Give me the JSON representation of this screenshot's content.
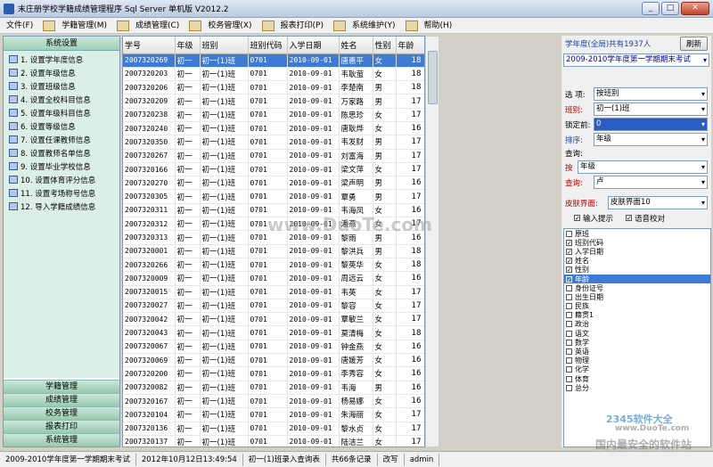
{
  "window": {
    "title": "末庄册学校学籍成绩管理程序 Sql Server 单机版 V2012.2",
    "min": "_",
    "max": "□",
    "close": "✕"
  },
  "menu": [
    "文件(F)",
    "学籍管理(M)",
    "成绩管理(C)",
    "校务管理(X)",
    "报表打印(P)",
    "系统维护(Y)",
    "帮助(H)"
  ],
  "left": {
    "header": "系统设置",
    "items": [
      "1. 设置学年度信息",
      "2. 设置年级信息",
      "3. 设置班级信息",
      "4. 设置全校科目信息",
      "5. 设置年级科目信息",
      "6. 设置等级信息",
      "7. 设置任课教师信息",
      "8. 设置教师名单信息",
      "9. 设置毕业学校信息",
      "10. 设置体育评分信息",
      "11. 设置考场称号信息",
      "12. 导入学籍成绩信息"
    ],
    "bottom": [
      "学籍管理",
      "成绩管理",
      "校务管理",
      "报表打印",
      "系统管理"
    ]
  },
  "grid": {
    "headers": [
      "学号",
      "年级",
      "班别",
      "班别代码",
      "入学日期",
      "姓名",
      "性别",
      "年龄"
    ],
    "rows": [
      [
        "2007320269",
        "初一",
        "初一(1)班",
        "0701",
        "2010-09-01",
        "唐惠平",
        "女",
        "18"
      ],
      [
        "2007320203",
        "初一",
        "初一(1)班",
        "0701",
        "2010-09-01",
        "韦耿萤",
        "女",
        "18"
      ],
      [
        "2007320206",
        "初一",
        "初一(1)班",
        "0701",
        "2010-09-01",
        "李楚南",
        "男",
        "18"
      ],
      [
        "2007320209",
        "初一",
        "初一(1)班",
        "0701",
        "2010-09-01",
        "万家路",
        "男",
        "17"
      ],
      [
        "2007320238",
        "初一",
        "初一(1)班",
        "0701",
        "2010-09-01",
        "陈思珍",
        "女",
        "17"
      ],
      [
        "2007320240",
        "初一",
        "初一(1)班",
        "0701",
        "2010-09-01",
        "唐耿烨",
        "女",
        "16"
      ],
      [
        "2007320350",
        "初一",
        "初一(1)班",
        "0701",
        "2010-09-01",
        "韦发财",
        "男",
        "17"
      ],
      [
        "2007320267",
        "初一",
        "初一(1)班",
        "0701",
        "2010-09-01",
        "刘富海",
        "男",
        "17"
      ],
      [
        "2007320166",
        "初一",
        "初一(1)班",
        "0701",
        "2010-09-01",
        "梁文萍",
        "女",
        "17"
      ],
      [
        "2007320270",
        "初一",
        "初一(1)班",
        "0701",
        "2010-09-01",
        "梁声明",
        "男",
        "16"
      ],
      [
        "2007320305",
        "初一",
        "初一(1)班",
        "0701",
        "2010-09-01",
        "覃勇",
        "男",
        "17"
      ],
      [
        "2007320311",
        "初一",
        "初一(1)班",
        "0701",
        "2010-09-01",
        "韦海凤",
        "女",
        "16"
      ],
      [
        "2007320312",
        "初一",
        "初一(1)班",
        "0701",
        "2010-09-01",
        "潘燕",
        "女",
        "17"
      ],
      [
        "2007320313",
        "初一",
        "初一(1)班",
        "0701",
        "2010-09-01",
        "黎雨",
        "男",
        "16"
      ],
      [
        "2007320001",
        "初一",
        "初一(1)班",
        "0701",
        "2010-09-01",
        "黎洪兵",
        "男",
        "18"
      ],
      [
        "2007320266",
        "初一",
        "初一(1)班",
        "0701",
        "2010-09-01",
        "黎英华",
        "女",
        "18"
      ],
      [
        "2007320009",
        "初一",
        "初一(1)班",
        "0701",
        "2010-09-01",
        "周远云",
        "女",
        "16"
      ],
      [
        "2007320015",
        "初一",
        "初一(1)班",
        "0701",
        "2010-09-01",
        "韦英",
        "女",
        "17"
      ],
      [
        "2007320027",
        "初一",
        "初一(1)班",
        "0701",
        "2010-09-01",
        "黎容",
        "女",
        "17"
      ],
      [
        "2007320042",
        "初一",
        "初一(1)班",
        "0701",
        "2010-09-01",
        "覃敏兰",
        "女",
        "17"
      ],
      [
        "2007320043",
        "初一",
        "初一(1)班",
        "0701",
        "2010-09-01",
        "莫清梅",
        "女",
        "18"
      ],
      [
        "2007320067",
        "初一",
        "初一(1)班",
        "0701",
        "2010-09-01",
        "钟金燕",
        "女",
        "16"
      ],
      [
        "2007320069",
        "初一",
        "初一(1)班",
        "0701",
        "2010-09-01",
        "唐媛芳",
        "女",
        "16"
      ],
      [
        "2007320200",
        "初一",
        "初一(1)班",
        "0701",
        "2010-09-01",
        "李秀容",
        "女",
        "16"
      ],
      [
        "2007320082",
        "初一",
        "初一(1)班",
        "0701",
        "2010-09-01",
        "韦海",
        "男",
        "16"
      ],
      [
        "2007320167",
        "初一",
        "初一(1)班",
        "0701",
        "2010-09-01",
        "杨易娜",
        "女",
        "16"
      ],
      [
        "2007320104",
        "初一",
        "初一(1)班",
        "0701",
        "2010-09-01",
        "朱海丽",
        "女",
        "17"
      ],
      [
        "2007320136",
        "初一",
        "初一(1)班",
        "0701",
        "2010-09-01",
        "黎水贞",
        "女",
        "17"
      ],
      [
        "2007320137",
        "初一",
        "初一(1)班",
        "0701",
        "2010-09-01",
        "陆洁兰",
        "女",
        "17"
      ],
      [
        "2007320147",
        "初一",
        "初一(1)班",
        "0701",
        "2010-09-01",
        "韦慧娜",
        "女",
        "16"
      ]
    ]
  },
  "right": {
    "count_label": "学年度(全局)共有1937人",
    "refresh": "刷新",
    "term": "2009-2010学年度第一学期期末考试",
    "select_label": "选 项:",
    "select_value": "按班别",
    "class_label": "班别:",
    "class_value": "初一(1)班",
    "lock_label": "锁定前:",
    "lock_value": "0",
    "sort_label": "排序:",
    "sort_value": "年级",
    "query_label": "查询:",
    "by_label": "按",
    "by_value": "年级",
    "query_value_label": "查询:",
    "query_value": "卢",
    "skin_label": "皮肤界面:",
    "skin_value": "皮肤界面10",
    "input_hint": "输入提示",
    "voice_check": "语音校对",
    "fields": [
      {
        "label": "原班",
        "checked": false
      },
      {
        "label": "班别代码",
        "checked": true
      },
      {
        "label": "入学日期",
        "checked": true
      },
      {
        "label": "姓名",
        "checked": true
      },
      {
        "label": "性别",
        "checked": true
      },
      {
        "label": "年龄",
        "checked": true,
        "highlight": true
      },
      {
        "label": "身份证号",
        "checked": false
      },
      {
        "label": "出生日期",
        "checked": false
      },
      {
        "label": "民族",
        "checked": false
      },
      {
        "label": "籍贯1",
        "checked": false
      },
      {
        "label": "政治",
        "checked": false
      },
      {
        "label": "语文",
        "checked": false
      },
      {
        "label": "数学",
        "checked": false
      },
      {
        "label": "英语",
        "checked": false
      },
      {
        "label": "物理",
        "checked": false
      },
      {
        "label": "化学",
        "checked": false
      },
      {
        "label": "体育",
        "checked": false
      },
      {
        "label": "总分",
        "checked": false
      }
    ]
  },
  "status": [
    "2009-2010学年度第一学期期末考试",
    "2012年10月12日13:49:54",
    "初一(1)班录入查询表",
    "共66条记录",
    "改写",
    "admin"
  ],
  "watermarks": [
    "www.DuoTe.com",
    "2345软件大全",
    "国内最安全的软件站",
    "www.DuoTe.com"
  ]
}
